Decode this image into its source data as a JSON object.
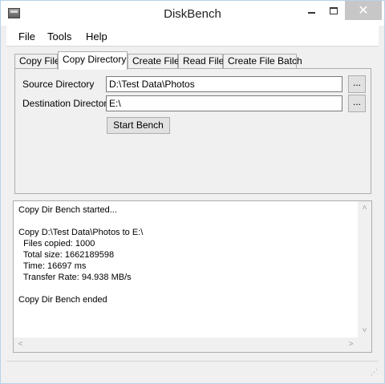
{
  "window": {
    "title": "DiskBench",
    "icon": "drive-icon",
    "controls": {
      "minimize": "minimize-icon",
      "maximize": "maximize-icon",
      "close": "✕"
    }
  },
  "menu": [
    "File",
    "Tools",
    "Help"
  ],
  "tabs": [
    {
      "label": "Copy File",
      "active": false
    },
    {
      "label": "Copy Directory",
      "active": true
    },
    {
      "label": "Create File",
      "active": false
    },
    {
      "label": "Read File",
      "active": false
    },
    {
      "label": "Create File Batch",
      "active": false
    }
  ],
  "form": {
    "source_label": "Source Directory",
    "source_value": "D:\\Test Data\\Photos",
    "dest_label": "Destination Directory",
    "dest_value": "E:\\",
    "browse_label": "...",
    "start_label": "Start Bench"
  },
  "log": {
    "lines": [
      "Copy Dir Bench started...",
      "",
      "Copy D:\\Test Data\\Photos to E:\\",
      "  Files copied: 1000",
      "  Total size: 1662189598",
      "  Time: 16697 ms",
      "  Transfer Rate: 94.938 MB/s",
      "",
      "Copy Dir Bench ended"
    ]
  },
  "scroll_arrows": {
    "up": "˄",
    "down": "˅",
    "left": "<",
    "right": ">"
  },
  "colors": {
    "close_button": "#c7c7c7",
    "window_border": "#b9d1ea",
    "client_bg": "#f0f0f0"
  }
}
